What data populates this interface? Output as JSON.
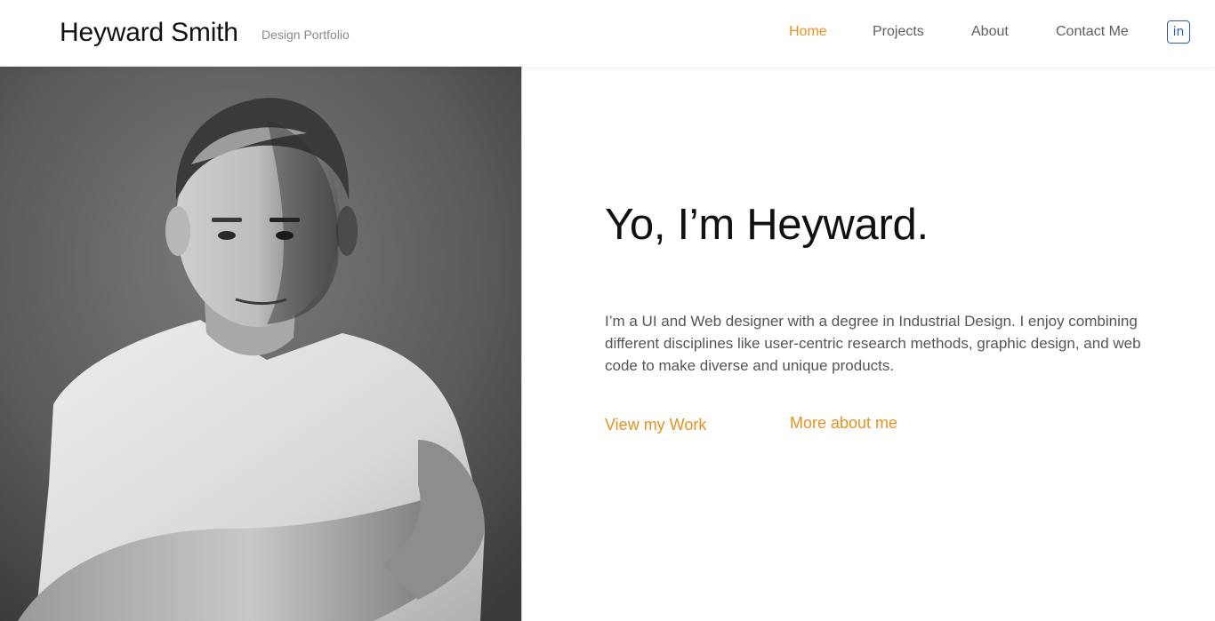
{
  "brand": {
    "name": "Heyward Smith",
    "tagline": "Design Portfolio"
  },
  "nav": {
    "items": [
      {
        "label": "Home",
        "active": true
      },
      {
        "label": "Projects",
        "active": false
      },
      {
        "label": "About",
        "active": false
      },
      {
        "label": "Contact Me",
        "active": false
      }
    ],
    "social": {
      "icon": "linkedin-icon",
      "label": "in"
    }
  },
  "hero": {
    "title": "Yo, I’m Heyward.",
    "body": "I’m a UI and Web designer with a degree in Industrial Design. I enjoy combining different disciplines like user-centric research methods, graphic design, and web code to make diverse and unique products.",
    "cta_primary": "View my Work",
    "cta_secondary": "More about me",
    "photo_alt": "portrait-photo"
  },
  "colors": {
    "accent": "#e8911e",
    "linkedin": "#2a5cb8",
    "text": "#111111",
    "muted": "#555555"
  }
}
